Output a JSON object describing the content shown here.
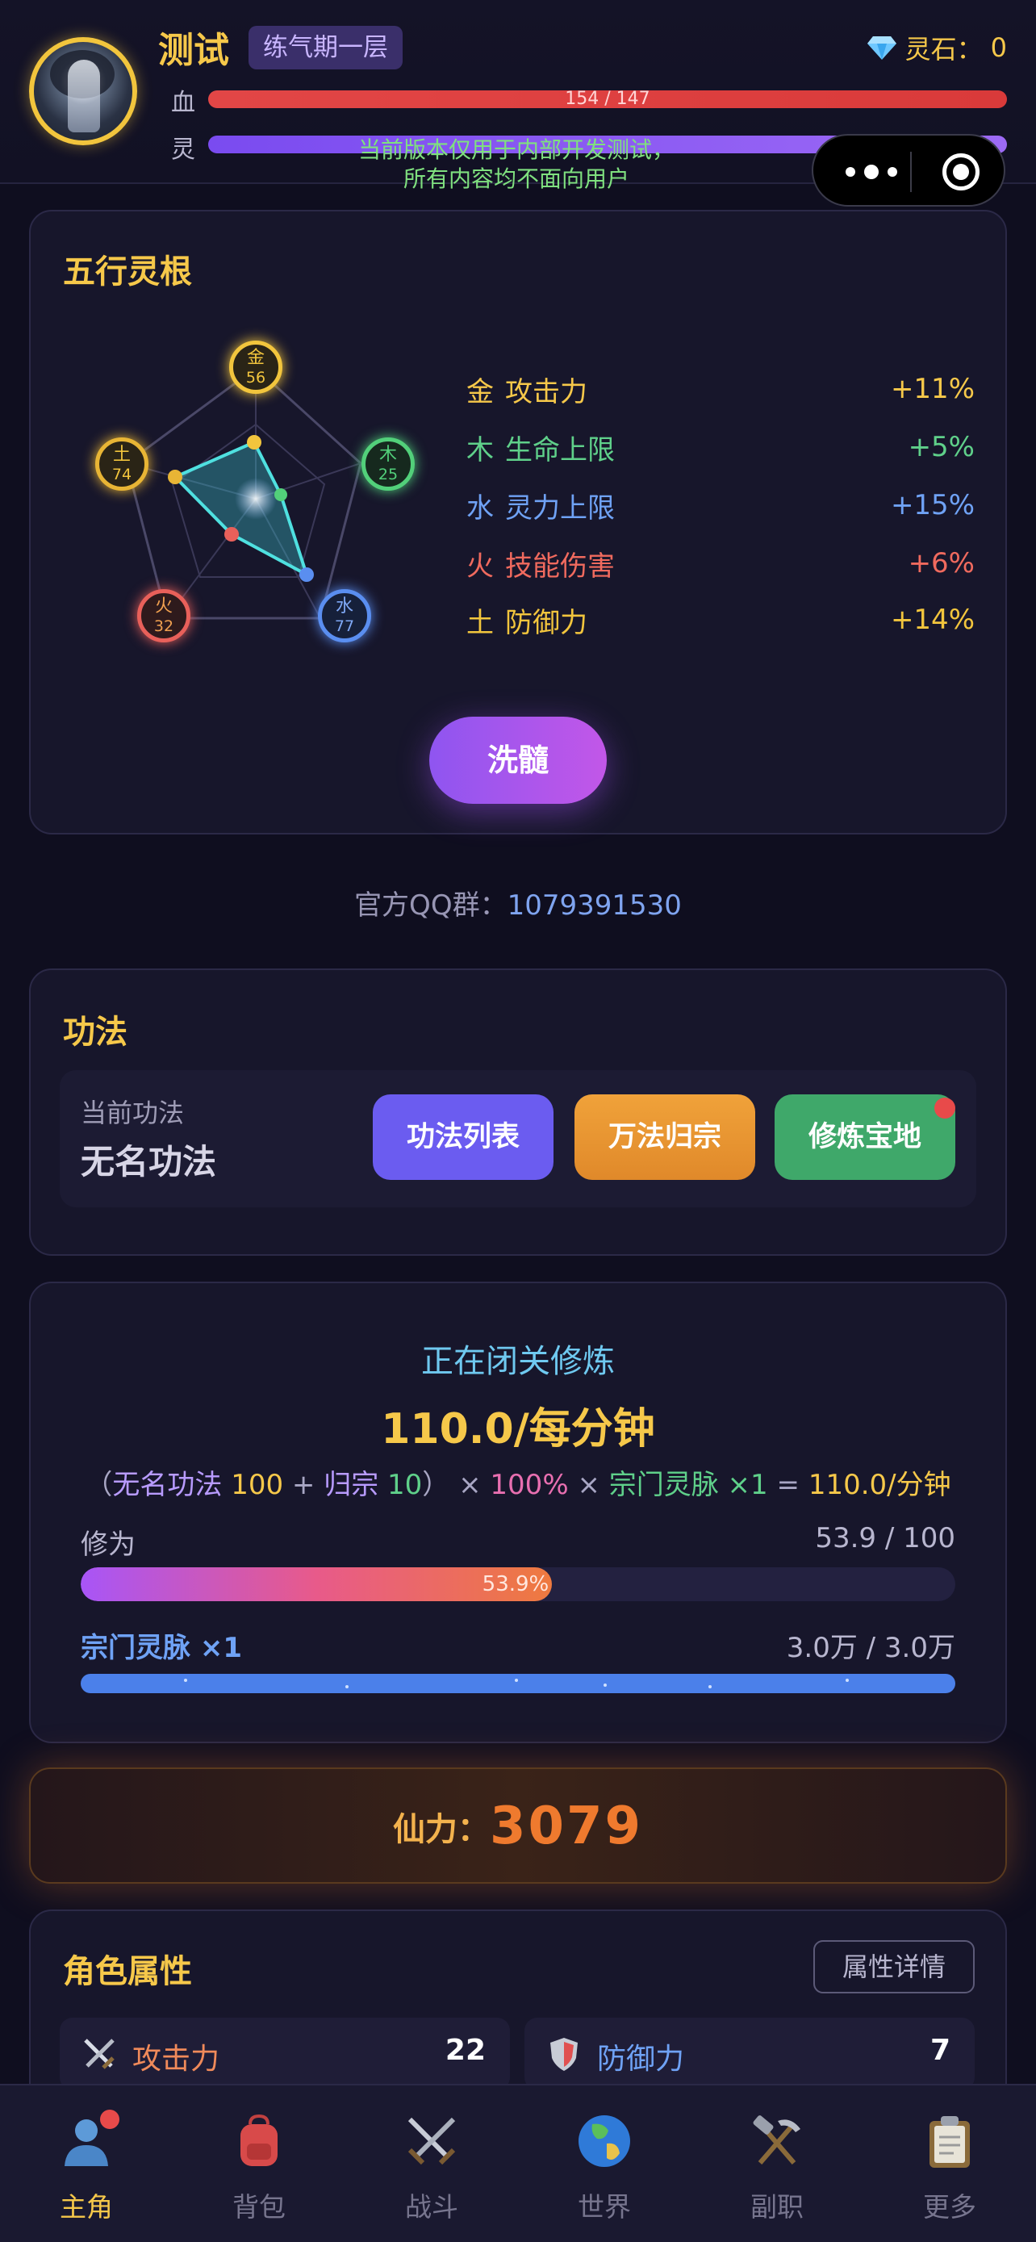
{
  "header": {
    "name": "测试",
    "realm": "练气期一层",
    "spirit_stone_label": "灵石：",
    "spirit_stone_value": "0",
    "hp_label": "血",
    "hp_text": "154 / 147",
    "sp_label": "灵",
    "notice_line1": "当前版本仅用于内部开发测试，",
    "notice_line2": "所有内容均不面向用户"
  },
  "wuxing": {
    "title": "五行灵根",
    "nodes": [
      {
        "name": "金",
        "value": "56",
        "color": "#f2c53d"
      },
      {
        "name": "木",
        "value": "25",
        "color": "#52d07a"
      },
      {
        "name": "水",
        "value": "77",
        "color": "#5a8ef0"
      },
      {
        "name": "火",
        "value": "32",
        "color": "#e8605a"
      },
      {
        "name": "土",
        "value": "74",
        "color": "#e8b535"
      }
    ],
    "bonuses": [
      {
        "element": "金",
        "stat": "攻击力",
        "value": "+11%",
        "color": "#f6c84a"
      },
      {
        "element": "木",
        "stat": "生命上限",
        "value": "+5%",
        "color": "#5fd08a"
      },
      {
        "element": "水",
        "stat": "灵力上限",
        "value": "+15%",
        "color": "#6fa2f5"
      },
      {
        "element": "火",
        "stat": "技能伤害",
        "value": "+6%",
        "color": "#f06a5e"
      },
      {
        "element": "土",
        "stat": "防御力",
        "value": "+14%",
        "color": "#f2c53d"
      }
    ],
    "wash_button": "洗髓"
  },
  "qq_group": {
    "label": "官方QQ群：",
    "number": "1079391530"
  },
  "technique": {
    "title": "功法",
    "current_label": "当前功法",
    "current_name": "无名功法",
    "buttons": [
      {
        "label": "功法列表",
        "color": "#6b5cf0"
      },
      {
        "label": "万法归宗",
        "color": "#e8962a"
      },
      {
        "label": "修炼宝地",
        "color": "#3fa86a"
      }
    ]
  },
  "cultivation": {
    "status": "正在闭关修炼",
    "rate": "110.0/每分钟",
    "formula": {
      "open": "（",
      "tech_name": "无名功法",
      "tech_value": "100",
      "plus": "+",
      "guizong_name": "归宗",
      "guizong_value": "10",
      "close": "）",
      "times1": "×",
      "pct": "100%",
      "times2": "×",
      "vein": "宗门灵脉 ×1",
      "equals": "=",
      "result": "110.0/分钟"
    },
    "xiuwei_label": "修为",
    "xiuwei_value": "53.9 / 100",
    "xiuwei_progress": 0.539,
    "xiuwei_pct": "53.9%",
    "vein_label": "宗门灵脉 ×1",
    "vein_value": "3.0万 / 3.0万",
    "vein_progress": 1.0
  },
  "power": {
    "label": "仙力：",
    "value": "3079"
  },
  "attributes": {
    "title": "角色属性",
    "detail_button": "属性详情",
    "items": [
      {
        "label": "攻击力",
        "value": "22",
        "icon": "sword-icon",
        "color": "#f08a5a"
      },
      {
        "label": "防御力",
        "value": "7",
        "icon": "shield-icon",
        "color": "#6fa2f5"
      }
    ]
  },
  "nav": {
    "items": [
      {
        "label": "主角",
        "icon": "person-icon",
        "active": true
      },
      {
        "label": "背包",
        "icon": "backpack-icon"
      },
      {
        "label": "战斗",
        "icon": "crossed-swords-icon"
      },
      {
        "label": "世界",
        "icon": "globe-icon"
      },
      {
        "label": "副职",
        "icon": "hammer-pick-icon"
      },
      {
        "label": "更多",
        "icon": "clipboard-icon"
      }
    ]
  }
}
